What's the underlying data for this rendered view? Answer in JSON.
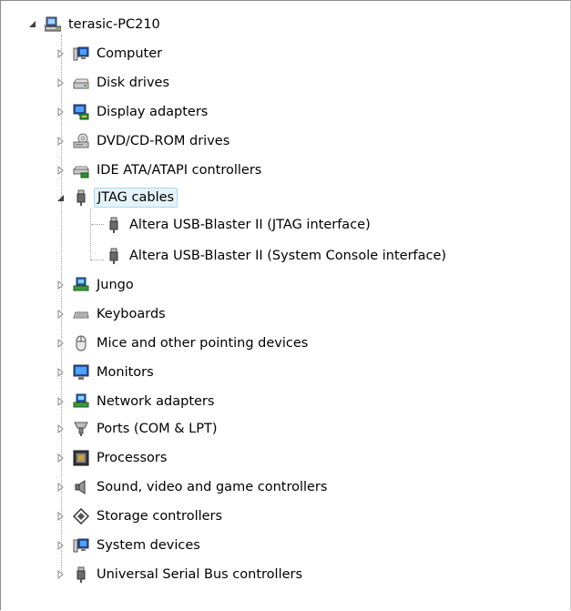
{
  "tree": {
    "root": {
      "label": "terasic-PC210",
      "icon": "computer-root-icon"
    },
    "categories": [
      {
        "label": "Computer",
        "icon": "computer-icon"
      },
      {
        "label": "Disk drives",
        "icon": "disk-drive-icon"
      },
      {
        "label": "Display adapters",
        "icon": "display-adapter-icon"
      },
      {
        "label": "DVD/CD-ROM drives",
        "icon": "dvd-drive-icon"
      },
      {
        "label": "IDE ATA/ATAPI controllers",
        "icon": "ide-controller-icon"
      },
      {
        "label": "JTAG cables",
        "icon": "usb-plug-icon"
      },
      {
        "label": "Jungo",
        "icon": "network-icon"
      },
      {
        "label": "Keyboards",
        "icon": "keyboard-icon"
      },
      {
        "label": "Mice and other pointing devices",
        "icon": "mouse-icon"
      },
      {
        "label": "Monitors",
        "icon": "monitor-icon"
      },
      {
        "label": "Network adapters",
        "icon": "network-icon"
      },
      {
        "label": "Ports (COM & LPT)",
        "icon": "port-icon"
      },
      {
        "label": "Processors",
        "icon": "processor-icon"
      },
      {
        "label": "Sound, video and game controllers",
        "icon": "speaker-icon"
      },
      {
        "label": "Storage controllers",
        "icon": "storage-icon"
      },
      {
        "label": "System devices",
        "icon": "system-device-icon"
      },
      {
        "label": "Universal Serial Bus controllers",
        "icon": "usb-plug-icon"
      }
    ],
    "jtag_children": [
      {
        "label": "Altera USB-Blaster II (JTAG interface)",
        "icon": "usb-plug-icon"
      },
      {
        "label": "Altera USB-Blaster II (System Console interface)",
        "icon": "usb-plug-icon"
      }
    ],
    "selected": "JTAG cables"
  }
}
